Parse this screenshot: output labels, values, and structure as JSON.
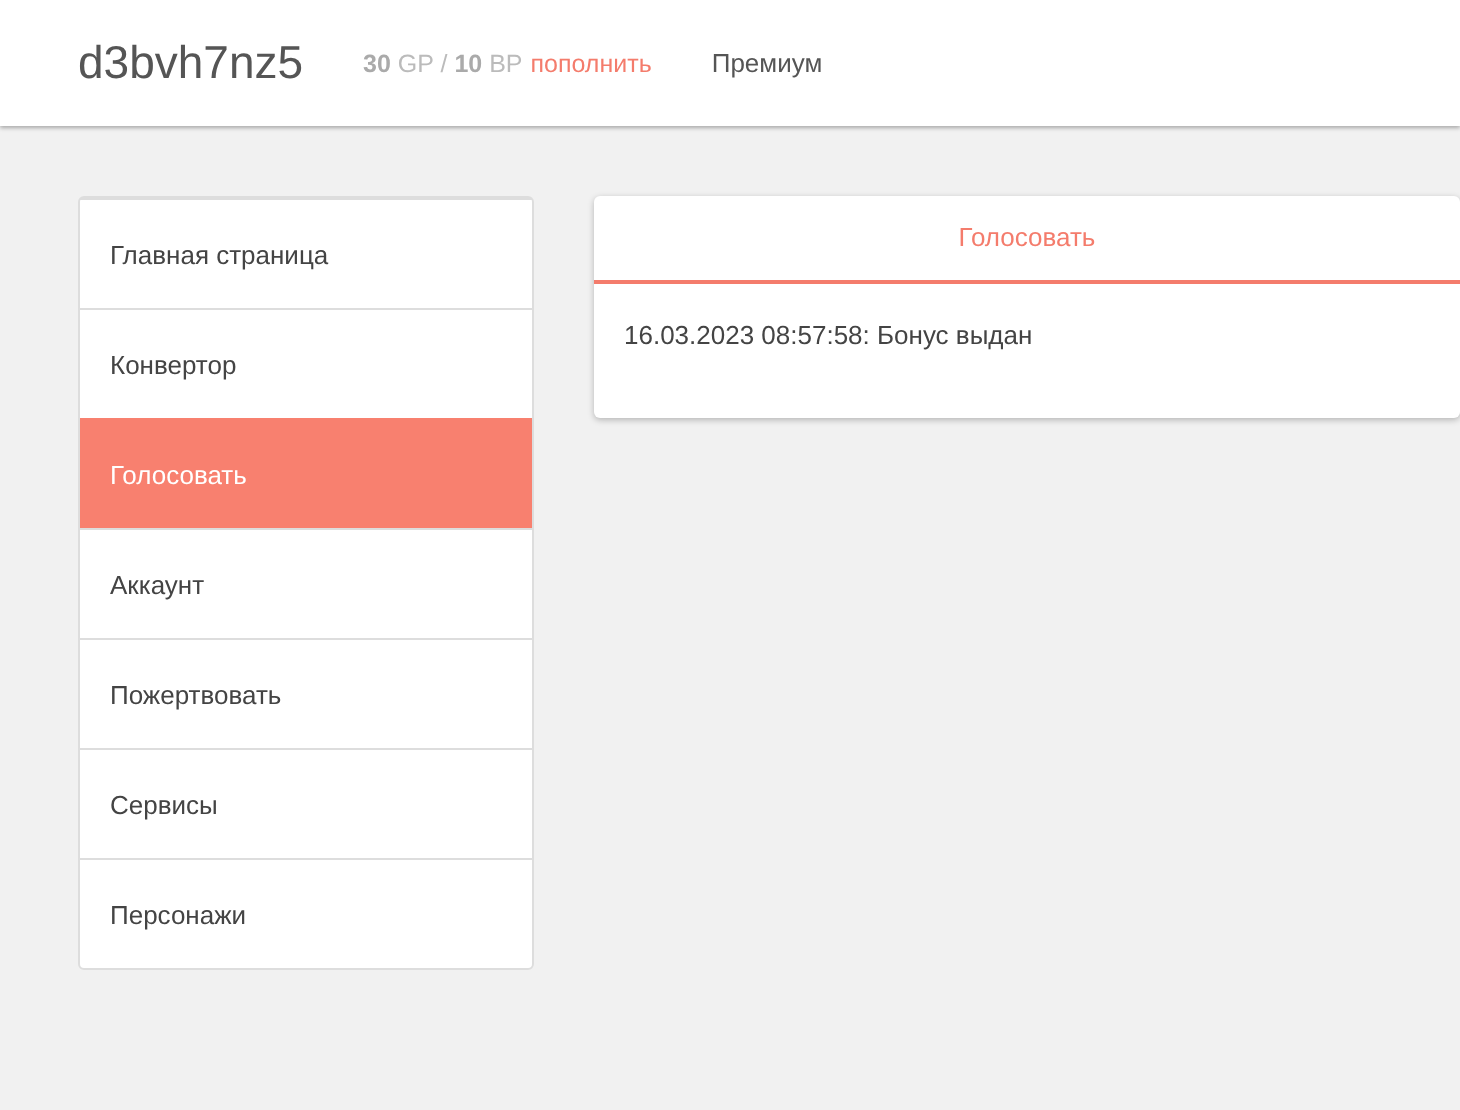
{
  "header": {
    "username": "d3bvh7nz5",
    "balance": "**30** GP / **10** BP",
    "topup_link": "пополнить",
    "premium_link": "Премиум"
  },
  "sidebar": {
    "items": [
      {
        "label": "Главная страница",
        "selected": false
      },
      {
        "label": "Конвертор",
        "selected": false
      },
      {
        "label": "Голосовать",
        "selected": true
      },
      {
        "label": "Аккаунт",
        "selected": false
      },
      {
        "label": "Пожертвовать",
        "selected": false
      },
      {
        "label": "Сервисы",
        "selected": false
      },
      {
        "label": "Персонажи",
        "selected": false
      }
    ]
  },
  "panel": {
    "tabs": [
      {
        "label": "Голосовать",
        "selected": true
      }
    ],
    "message": "16.03.2023 08:57:58: Бонус выдан"
  }
}
